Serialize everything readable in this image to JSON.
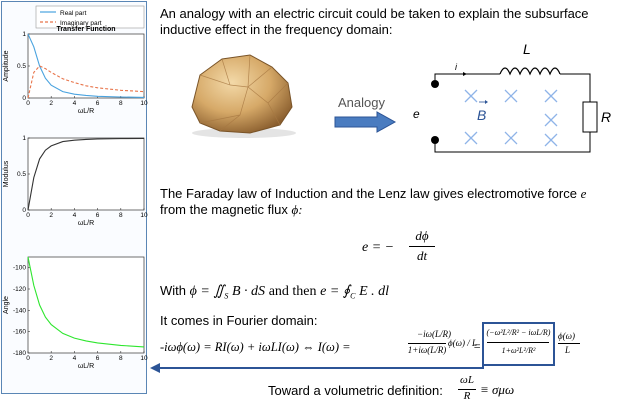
{
  "left_panel": {
    "legend": {
      "real": "Real part",
      "imaginary": "Imaginary part"
    },
    "charts": [
      {
        "title": "Transfer Function",
        "ylabel": "Amplitude",
        "xlabel": "ωL/R",
        "yticks": [
          "1",
          "0.5",
          "0"
        ],
        "xticks": [
          "0",
          "2",
          "4",
          "6",
          "8",
          "10"
        ]
      },
      {
        "title": "",
        "ylabel": "Modulus",
        "xlabel": "ωL/R",
        "yticks": [
          "1",
          "0.5",
          "0"
        ],
        "xticks": [
          "0",
          "2",
          "4",
          "6",
          "8",
          "10"
        ]
      },
      {
        "title": "",
        "ylabel": "Angle",
        "xlabel": "ωL/R",
        "yticks": [
          "-100",
          "-120",
          "-140",
          "-160",
          "-180"
        ],
        "xticks": [
          "0",
          "2",
          "4",
          "6",
          "8",
          "10"
        ]
      }
    ],
    "colors": {
      "real": "#4aa3df",
      "imaginary": "#e8744a",
      "modulus": "#333333",
      "angle": "#2ee62e"
    }
  },
  "chart_data": [
    {
      "type": "line",
      "title": "Transfer Function",
      "xlabel": "ωL/R",
      "ylabel": "Amplitude",
      "xlim": [
        0,
        10
      ],
      "ylim": [
        0,
        1
      ],
      "x": [
        0,
        0.5,
        1,
        1.5,
        2,
        3,
        4,
        5,
        6,
        8,
        10
      ],
      "series": [
        {
          "name": "Real part",
          "style": "solid",
          "values": [
            1.0,
            0.8,
            0.5,
            0.31,
            0.2,
            0.1,
            0.06,
            0.04,
            0.027,
            0.015,
            0.01
          ]
        },
        {
          "name": "Imaginary part",
          "style": "dashed",
          "values": [
            0.0,
            0.4,
            0.5,
            0.46,
            0.4,
            0.3,
            0.24,
            0.19,
            0.16,
            0.12,
            0.1
          ]
        }
      ]
    },
    {
      "type": "line",
      "xlabel": "ωL/R",
      "ylabel": "Modulus",
      "xlim": [
        0,
        10
      ],
      "ylim": [
        0,
        1
      ],
      "x": [
        0,
        0.5,
        1,
        1.5,
        2,
        3,
        4,
        5,
        6,
        8,
        10
      ],
      "series": [
        {
          "values": [
            0.0,
            0.45,
            0.71,
            0.83,
            0.89,
            0.95,
            0.97,
            0.98,
            0.986,
            0.992,
            0.995
          ]
        }
      ]
    },
    {
      "type": "line",
      "xlabel": "ωL/R",
      "ylabel": "Angle",
      "xlim": [
        0,
        10
      ],
      "ylim": [
        -180,
        -90
      ],
      "x": [
        0,
        0.5,
        1,
        1.5,
        2,
        3,
        4,
        5,
        6,
        8,
        10
      ],
      "series": [
        {
          "values": [
            -90,
            -116.6,
            -135,
            -146.3,
            -153.4,
            -161.6,
            -166.0,
            -168.7,
            -170.5,
            -172.9,
            -174.3
          ]
        }
      ]
    }
  ],
  "intro": {
    "line1": "An analogy with an electric circuit could be taken to explain the subsurface",
    "line2": "inductive effect in the frequency domain:"
  },
  "analogy_label": "Analogy",
  "circuit": {
    "inductor": "L",
    "resistor": "R",
    "current": "i",
    "emf": "e",
    "field": "B"
  },
  "faraday": {
    "line1": "The Faraday law of Induction and the Lenz law gives electromotive force",
    "line1_var": "e",
    "line2": "from the magnetic flux",
    "line2_var": "ϕ:"
  },
  "equations": {
    "emf_lhs": "e = −",
    "emf_num": "dϕ",
    "emf_den": "dt",
    "with": "With",
    "phi_def": "ϕ = ∬",
    "phi_sub": "S",
    "phi_body": "B · dS",
    "and_then": "and then",
    "e_def": "e = ∮",
    "e_sub": "C",
    "e_body": "E . dl",
    "fourier_intro": "It comes in Fourier domain:",
    "fourier_lhs": "-iωϕ(ω)  =  RI(ω) + iωLI(ω)  ⇔  I(ω) =",
    "frac1_num": "−iω(L/R)",
    "frac1_den": "1+iω(L/R)",
    "frac1_tail": "ϕ(ω) / L",
    "frac2_num": "(−ω²L²/R² − iωL/R)",
    "frac2_den": "1+ω²L²/R²",
    "frac2_tail_num": "ϕ(ω)",
    "frac2_tail_den": "L",
    "volumetric_text": "Toward a volumetric definition:",
    "volumetric_num": "ωL",
    "volumetric_den": "R",
    "volumetric_rhs": "≡ σμω"
  }
}
